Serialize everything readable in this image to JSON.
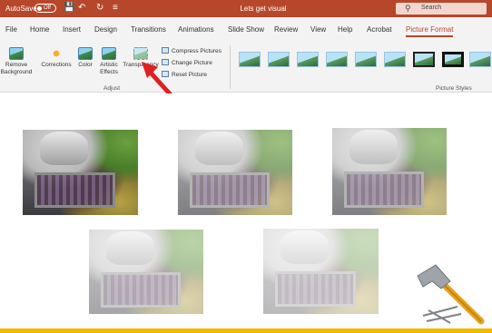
{
  "titlebar": {
    "autosave_label": "AutoSave",
    "autosave_state": "Off",
    "doc_title": "Lets get visual",
    "search_placeholder": "Search",
    "qat_icons": [
      "save-icon",
      "undo-icon",
      "redo-icon",
      "customize-icon"
    ]
  },
  "tabs": [
    "File",
    "Home",
    "Insert",
    "Design",
    "Transitions",
    "Animations",
    "Slide Show",
    "Review",
    "View",
    "Help",
    "Acrobat",
    "Picture Format"
  ],
  "active_tab": "Picture Format",
  "ribbon": {
    "remove_background": "Remove Background",
    "corrections": "Corrections",
    "color": "Color",
    "artistic_effects": "Artistic Effects",
    "transparency": "Transparency",
    "compress_pictures": "Compress Pictures",
    "change_picture": "Change Picture",
    "reset_picture": "Reset Picture",
    "adjust_group": "Adjust",
    "picture_styles_group": "Picture Styles"
  },
  "colors": {
    "accent": "#b7472a",
    "ribbon_bg": "#f3f3f3",
    "annotation_arrow": "#e02020",
    "footer_bar": "#f2b900"
  },
  "slide": {
    "photos": [
      {
        "name": "photo-1",
        "transparency": 0
      },
      {
        "name": "photo-2",
        "transparency": 0.35
      },
      {
        "name": "photo-3",
        "transparency": 0.35
      },
      {
        "name": "photo-4",
        "transparency": 0.55
      },
      {
        "name": "photo-5",
        "transparency": 0.65
      }
    ]
  }
}
